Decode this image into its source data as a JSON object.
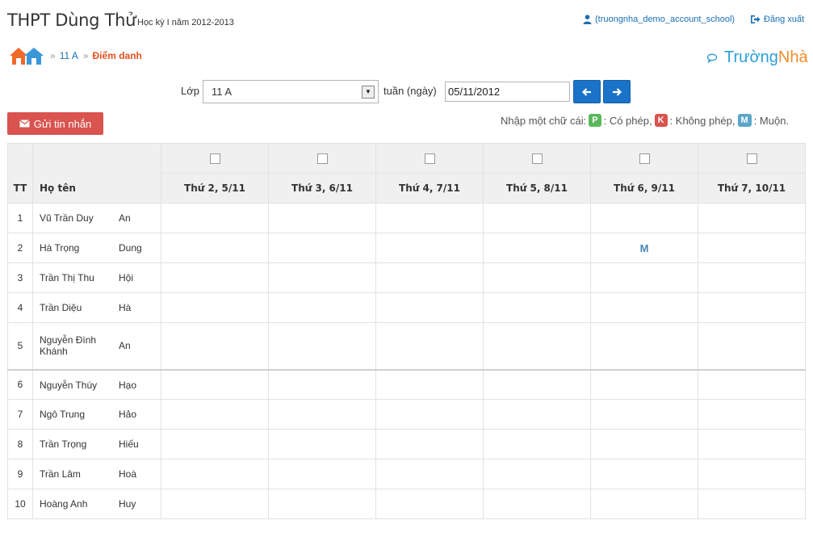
{
  "header": {
    "app_title": "THPT Dùng Thử",
    "term": "Học kỳ I năm 2012-2013",
    "user": "(truongnha_demo_account_school)",
    "logout": "Đăng xuất"
  },
  "breadcrumb": {
    "sep": "»",
    "class": "11 A",
    "current": "Điểm danh"
  },
  "brand": {
    "part1": "Trường",
    "part2": "Nhà"
  },
  "filters": {
    "class_label": "Lớp",
    "class_value": "11 A",
    "week_label": "tuần (ngày)",
    "date_value": "05/11/2012"
  },
  "actions": {
    "send_message": "Gửi tin nhắn"
  },
  "legend": {
    "intro": "Nhập một chữ cái:",
    "p_key": "P",
    "p_text": ": Có phép,",
    "k_key": "K",
    "k_text": ": Không phép,",
    "m_key": "M",
    "m_text": ": Muộn."
  },
  "table": {
    "col_tt": "TT",
    "col_name": "Họ tên",
    "days": [
      "Thứ 2, 5/11",
      "Thứ 3, 6/11",
      "Thứ 4, 7/11",
      "Thứ 5, 8/11",
      "Thứ 6, 9/11",
      "Thứ 7, 10/11"
    ],
    "rows": [
      {
        "tt": "1",
        "last": "Vũ Trần Duy",
        "first": "An",
        "marks": [
          "",
          "",
          "",
          "",
          "",
          ""
        ]
      },
      {
        "tt": "2",
        "last": "Hà Trọng",
        "first": "Dung",
        "marks": [
          "",
          "",
          "",
          "",
          "M",
          ""
        ]
      },
      {
        "tt": "3",
        "last": "Trần Thị Thu",
        "first": "Hội",
        "marks": [
          "",
          "",
          "",
          "",
          "",
          ""
        ]
      },
      {
        "tt": "4",
        "last": "Trần Diệu",
        "first": "Hà",
        "marks": [
          "",
          "",
          "",
          "",
          "",
          ""
        ]
      },
      {
        "tt": "5",
        "last": "Nguyễn Đình Khánh",
        "first": "An",
        "marks": [
          "",
          "",
          "",
          "",
          "",
          ""
        ]
      },
      {
        "tt": "6",
        "last": "Nguyễn Thúy",
        "first": "Hạo",
        "marks": [
          "",
          "",
          "",
          "",
          "",
          ""
        ]
      },
      {
        "tt": "7",
        "last": "Ngô Trung",
        "first": "Hảo",
        "marks": [
          "",
          "",
          "",
          "",
          "",
          ""
        ]
      },
      {
        "tt": "8",
        "last": "Trần Trọng",
        "first": "Hiếu",
        "marks": [
          "",
          "",
          "",
          "",
          "",
          ""
        ]
      },
      {
        "tt": "9",
        "last": "Trần Lâm",
        "first": "Hoà",
        "marks": [
          "",
          "",
          "",
          "",
          "",
          ""
        ]
      },
      {
        "tt": "10",
        "last": "Hoàng Anh",
        "first": "Huy",
        "marks": [
          "",
          "",
          "",
          "",
          "",
          ""
        ]
      }
    ]
  },
  "colors": {
    "link": "#1a6fb4",
    "current_crumb": "#e4511f",
    "primary_button": "#1a73c8",
    "danger_button": "#d9534f",
    "badge_p": "#5cb85c",
    "badge_k": "#d9534f",
    "badge_m": "#5ba5c9"
  },
  "icons": {
    "home": "home-icon",
    "user": "user-icon",
    "logout": "logout-icon",
    "envelope": "envelope-icon",
    "chat": "chat-bubble-icon",
    "prev": "arrow-left-icon",
    "next": "arrow-right-icon"
  }
}
